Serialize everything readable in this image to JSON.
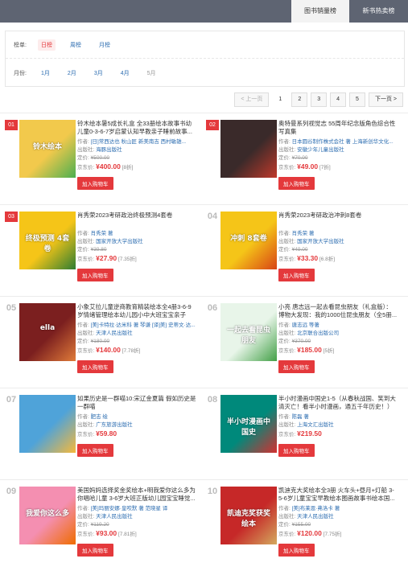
{
  "tabs": {
    "sales": "图书销量榜",
    "new": "新书热卖榜"
  },
  "filter": {
    "list_label": "榜单:",
    "list_options": [
      "日榜",
      "周榜",
      "月榜"
    ],
    "month_label": "月份:",
    "months": [
      "1月",
      "2月",
      "3月",
      "4月",
      "5月"
    ]
  },
  "pager": {
    "prev": "< 上一页",
    "pages": [
      "1",
      "2",
      "3",
      "4",
      "5"
    ],
    "next": "下一页 >"
  },
  "labels": {
    "author": "作者:",
    "publisher": "出版社:",
    "list_price": "定价:",
    "jd_price": "京东价:",
    "buy": "加入购物车"
  },
  "items": [
    {
      "rank": "01",
      "title": "铃木绘本暑5成长礼盒 全33册绘本故事书幼儿童0-3-6-7岁启蒙认知早教亲子睡前故事...",
      "author": "[日]常西达也  秋山匠  新美南吉  西村敏雄...",
      "publisher": "海豚出版社",
      "orig": "¥500.00",
      "price": "¥400.00",
      "disc": "[8折]",
      "cover_text": "铃木绘本",
      "colors": [
        "#f2c94c",
        "#4caf50"
      ]
    },
    {
      "rank": "02",
      "title": "奥特曼系列视觉志 55周年纪念版角色综合性写真集",
      "author": "日本圆谷制作株式会社  著  上海新创华文化...",
      "publisher": "安徽少年儿童出版社",
      "orig": "¥70.00",
      "price": "¥49.00",
      "disc": "[7折]",
      "cover_text": "",
      "colors": [
        "#3a2a2a",
        "#c0392b"
      ]
    },
    {
      "rank": "03",
      "title": "肖秀荣2023考研政治终极预测4套卷",
      "author": "肖秀荣  著",
      "publisher": "国家开放大学出版社",
      "orig": "¥39.80",
      "price": "¥27.90",
      "disc": "[7.35折]",
      "cover_text": "终极预测 4套卷",
      "colors": [
        "#f5c518",
        "#2e7d32"
      ]
    },
    {
      "rank": "04",
      "title": "肖秀荣2023考研政治冲刺8套卷",
      "author": "肖秀荣  著",
      "publisher": "国家开放大学出版社",
      "orig": "¥49.00",
      "price": "¥33.30",
      "disc": "[6.8折]",
      "cover_text": "冲刺 8套卷",
      "colors": [
        "#f5c518",
        "#d84315"
      ]
    },
    {
      "rank": "05",
      "title": "小象艾拉儿童逆商教育精装绘本全4册3-6-9岁情绪管理绘本幼儿园小中大班宝宝亲子早...",
      "author": "[美]卡特拉·达米科  著  琴谦  [译]美] 史蒂文·达...",
      "publisher": "天津人民出版社",
      "orig": "¥180.00",
      "price": "¥140.00",
      "disc": "[7.78折]",
      "cover_text": "ella",
      "colors": [
        "#7b1f1f",
        "#e07b39"
      ]
    },
    {
      "rank": "06",
      "title": "小亮 唐志远一起去看昆虫朋友（礼盒版）：博物大发现：我的1000位昆虫朋友（全5册...",
      "author": "唐志远  等著",
      "publisher": "北京联合出版公司",
      "orig": "¥370.00",
      "price": "¥185.00",
      "disc": "[5折]",
      "cover_text": "一起去看昆虫朋友",
      "colors": [
        "#e8f5e9",
        "#43a047"
      ]
    },
    {
      "rank": "07",
      "title": "如果历史是一群喵10:宋辽金夏篇 假如历史是一群喵",
      "author": "肥志  绘",
      "publisher": "广东旅游出版社",
      "orig": "",
      "price": "¥59.80",
      "disc": "",
      "cover_text": "",
      "colors": [
        "#4fa3d9",
        "#f6b93b"
      ]
    },
    {
      "rank": "08",
      "title": "半小时漫画中国史1-5（从春秋战国、笑到大清灭亡！看半小时漫画，通五千年历史！）",
      "author": "陈磊  著",
      "publisher": "上海文汇出版社",
      "orig": "",
      "price": "¥219.50",
      "disc": "",
      "cover_text": "半小时漫画中国史",
      "colors": [
        "#00897b",
        "#d32f2f"
      ]
    },
    {
      "rank": "09",
      "title": "美国妈妈选择奖金奖绘本+明我爱你这么多为你唱哈儿童 3-6岁大班正版幼儿园宝宝睡觉...",
      "author": "[美]玛丽安娜·皇咬默  著  范晓星  译",
      "publisher": "天津人民出版社",
      "orig": "¥119.20",
      "price": "¥93.00",
      "disc": "[7.81折]",
      "cover_text": "我爱你这么多",
      "colors": [
        "#f48fb1",
        "#ef6c00"
      ]
    },
    {
      "rank": "10",
      "title": "凯迪克大奖绘本全3册 火车头+昼月+灯船 3-5-6岁儿童宝宝早教绘本图画故事书绘本国...",
      "author": "[美]布莱恩·弗洛卡  著",
      "publisher": "天津人民出版社",
      "orig": "¥155.00",
      "price": "¥120.00",
      "disc": "[7.75折]",
      "cover_text": "凯迪克奖获奖绘本",
      "colors": [
        "#c62828",
        "#d4a95e"
      ]
    }
  ]
}
